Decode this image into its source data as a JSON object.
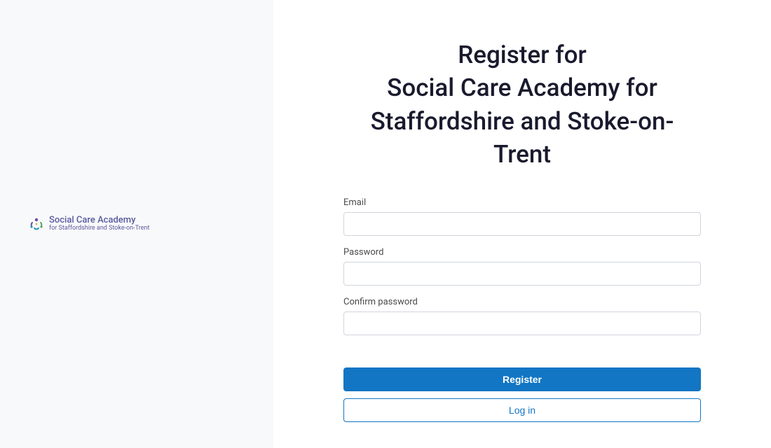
{
  "logo": {
    "title": "Social Care Academy",
    "subtitle": "for Staffordshire and Stoke-on-Trent"
  },
  "heading": "Register for\nSocial Care Academy for Staffordshire and Stoke-on-Trent",
  "form": {
    "email_label": "Email",
    "email_value": "",
    "password_label": "Password",
    "password_value": "",
    "confirm_password_label": "Confirm password",
    "confirm_password_value": ""
  },
  "buttons": {
    "register": "Register",
    "login": "Log in"
  },
  "colors": {
    "primary": "#1276c4",
    "heading": "#1a1a2e",
    "left_bg": "#f8f9fa",
    "logo_purple": "#5a5a9e"
  }
}
